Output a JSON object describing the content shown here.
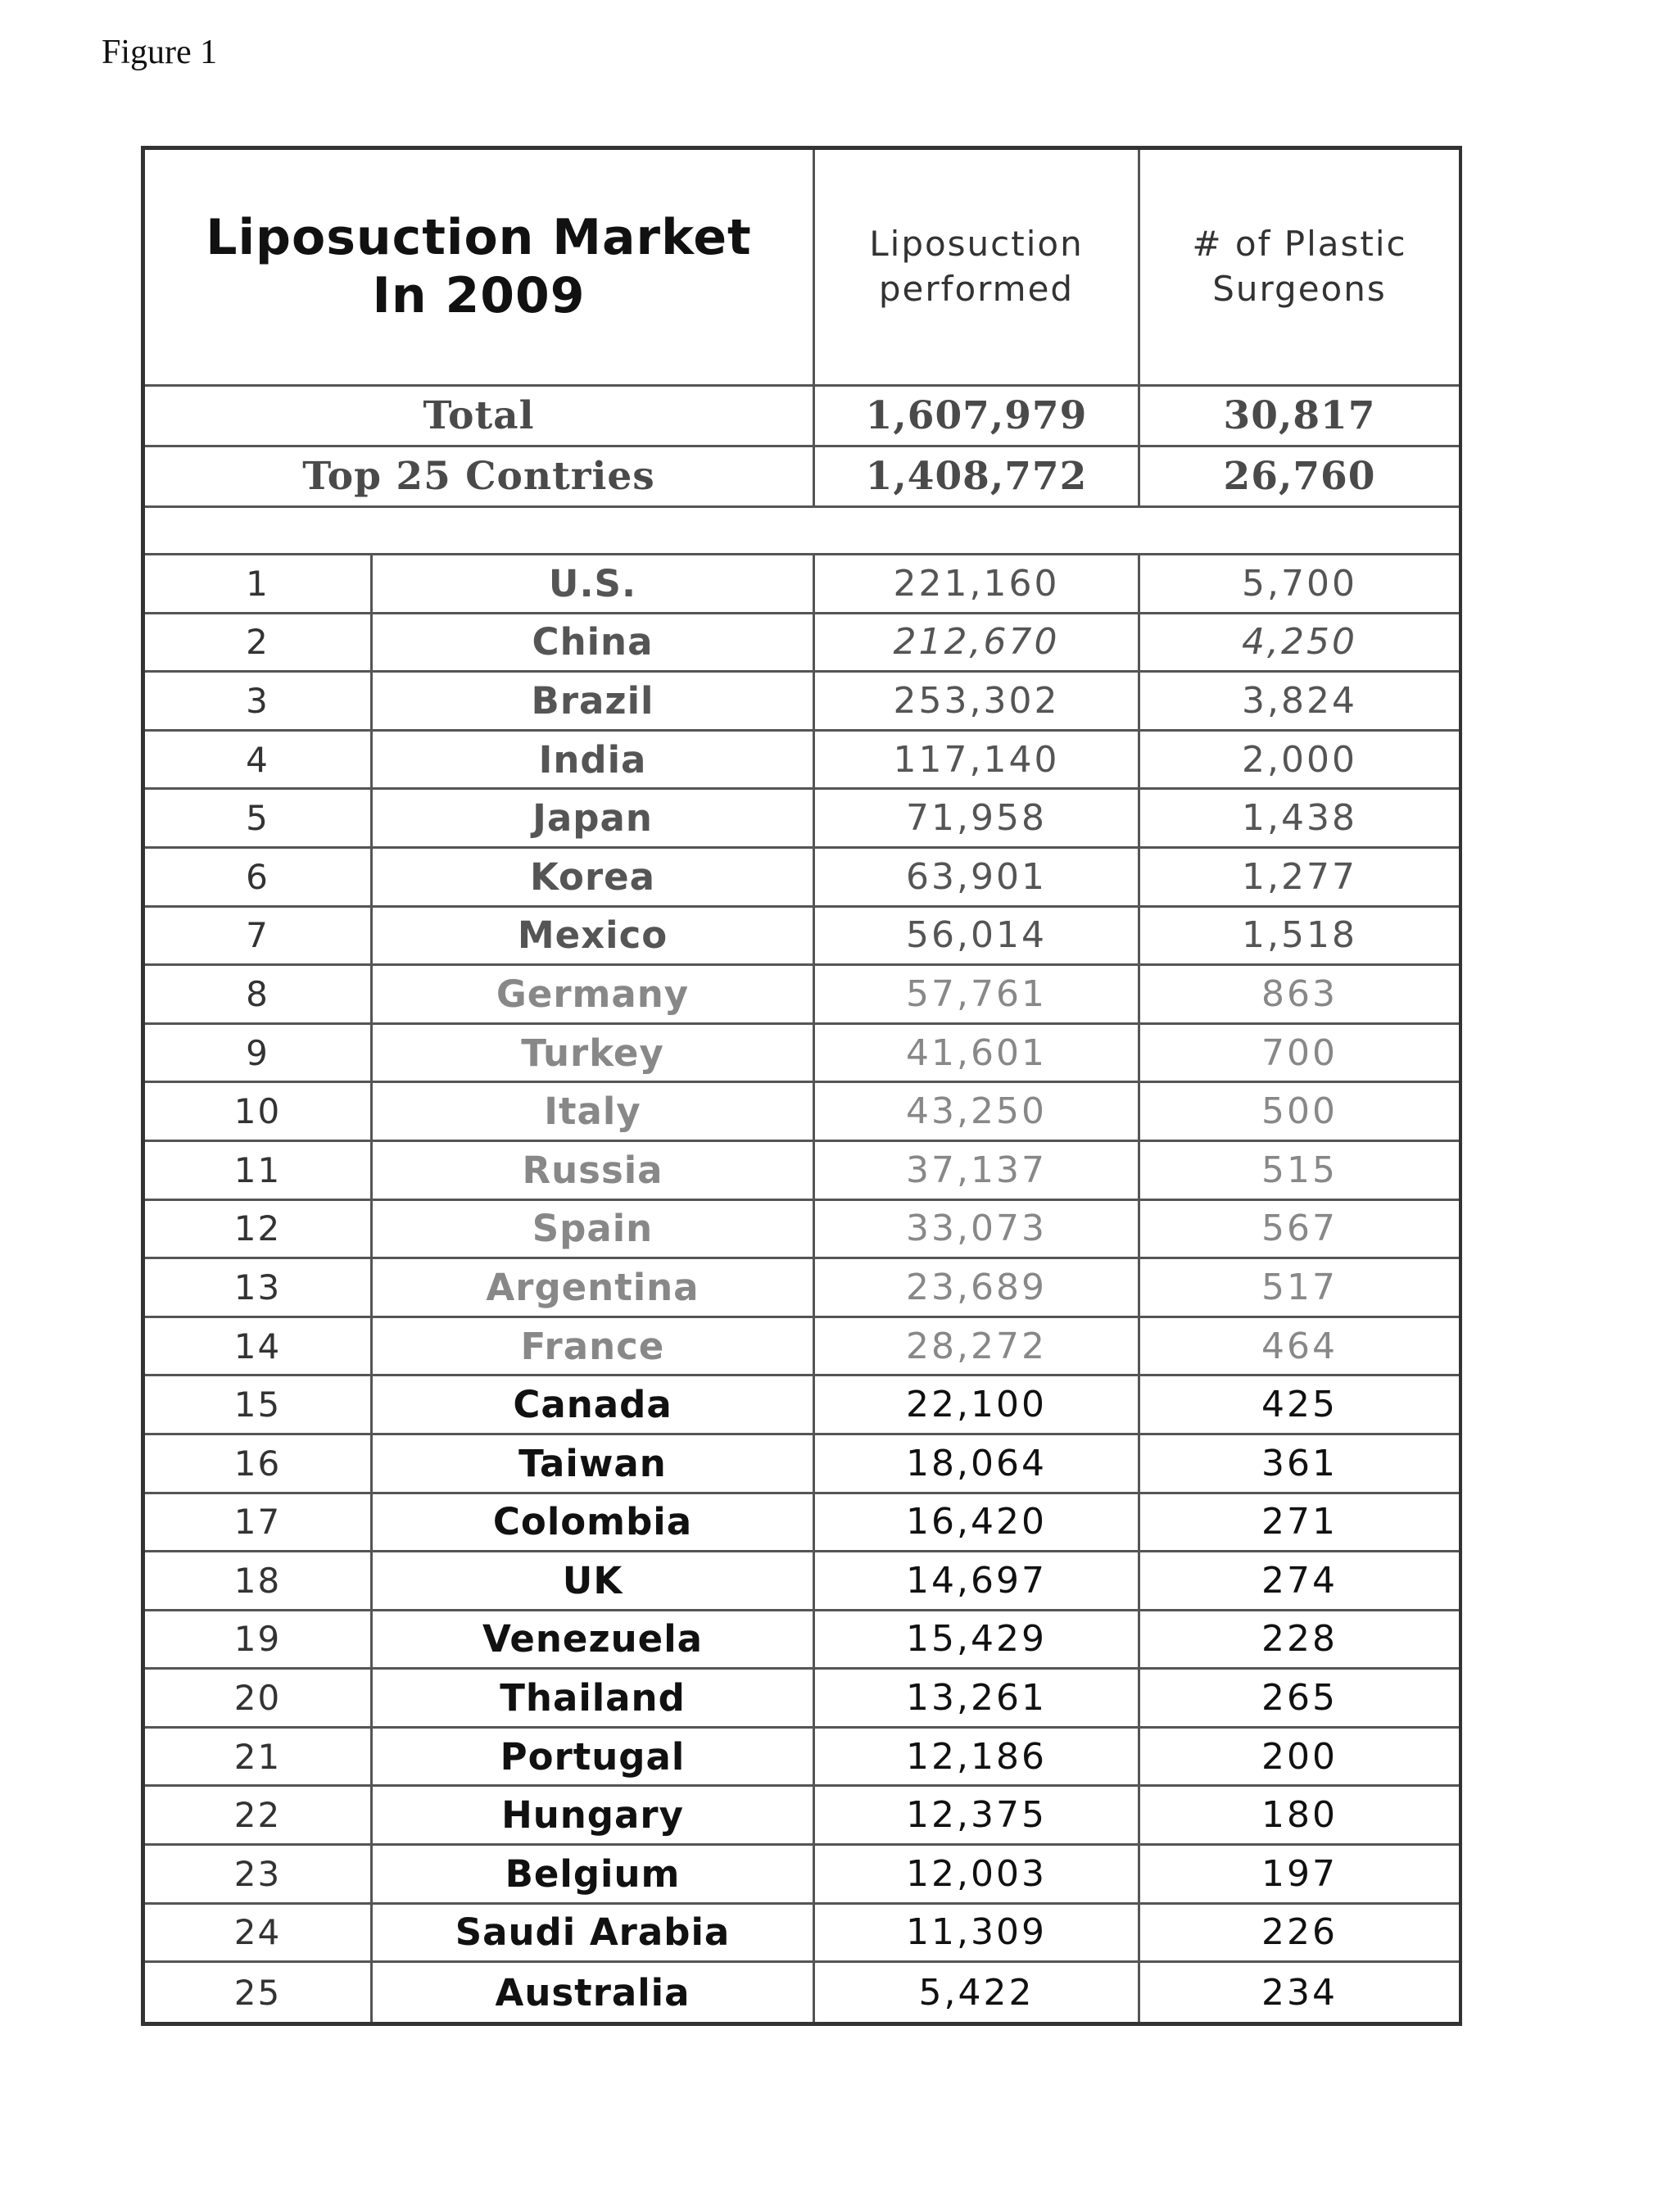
{
  "figure_label": "Figure 1",
  "table": {
    "title": "Liposuction Market In 2009",
    "title_line1": "Liposuction Market",
    "title_line2": "In 2009",
    "columns": {
      "liposuction_line1": "Liposuction",
      "liposuction_line2": "performed",
      "surgeons_line1": "# of Plastic",
      "surgeons_line2": "Surgeons"
    },
    "summary": [
      {
        "label": "Total",
        "liposuction": "1,607,979",
        "surgeons": "30,817"
      },
      {
        "label": "Top 25 Contries",
        "liposuction": "1,408,772",
        "surgeons": "26,760"
      }
    ],
    "rows": [
      {
        "rank": "1",
        "country": "U.S.",
        "liposuction": "221,160",
        "surgeons": "5,700",
        "tone": "mid"
      },
      {
        "rank": "2",
        "country": "China",
        "liposuction": "212,670",
        "surgeons": "4,250",
        "tone": "mid",
        "italic_values": true
      },
      {
        "rank": "3",
        "country": "Brazil",
        "liposuction": "253,302",
        "surgeons": "3,824",
        "tone": "mid"
      },
      {
        "rank": "4",
        "country": "India",
        "liposuction": "117,140",
        "surgeons": "2,000",
        "tone": "mid"
      },
      {
        "rank": "5",
        "country": "Japan",
        "liposuction": "71,958",
        "surgeons": "1,438",
        "tone": "mid"
      },
      {
        "rank": "6",
        "country": "Korea",
        "liposuction": "63,901",
        "surgeons": "1,277",
        "tone": "mid"
      },
      {
        "rank": "7",
        "country": "Mexico",
        "liposuction": "56,014",
        "surgeons": "1,518",
        "tone": "mid"
      },
      {
        "rank": "8",
        "country": "Germany",
        "liposuction": "57,761",
        "surgeons": "863",
        "tone": "light"
      },
      {
        "rank": "9",
        "country": "Turkey",
        "liposuction": "41,601",
        "surgeons": "700",
        "tone": "light"
      },
      {
        "rank": "10",
        "country": "Italy",
        "liposuction": "43,250",
        "surgeons": "500",
        "tone": "light"
      },
      {
        "rank": "11",
        "country": "Russia",
        "liposuction": "37,137",
        "surgeons": "515",
        "tone": "light"
      },
      {
        "rank": "12",
        "country": "Spain",
        "liposuction": "33,073",
        "surgeons": "567",
        "tone": "light"
      },
      {
        "rank": "13",
        "country": "Argentina",
        "liposuction": "23,689",
        "surgeons": "517",
        "tone": "light"
      },
      {
        "rank": "14",
        "country": "France",
        "liposuction": "28,272",
        "surgeons": "464",
        "tone": "light"
      },
      {
        "rank": "15",
        "country": "Canada",
        "liposuction": "22,100",
        "surgeons": "425",
        "tone": "dark"
      },
      {
        "rank": "16",
        "country": "Taiwan",
        "liposuction": "18,064",
        "surgeons": "361",
        "tone": "dark"
      },
      {
        "rank": "17",
        "country": "Colombia",
        "liposuction": "16,420",
        "surgeons": "271",
        "tone": "dark"
      },
      {
        "rank": "18",
        "country": "UK",
        "liposuction": "14,697",
        "surgeons": "274",
        "tone": "dark"
      },
      {
        "rank": "19",
        "country": "Venezuela",
        "liposuction": "15,429",
        "surgeons": "228",
        "tone": "dark"
      },
      {
        "rank": "20",
        "country": "Thailand",
        "liposuction": "13,261",
        "surgeons": "265",
        "tone": "dark"
      },
      {
        "rank": "21",
        "country": "Portugal",
        "liposuction": "12,186",
        "surgeons": "200",
        "tone": "dark"
      },
      {
        "rank": "22",
        "country": "Hungary",
        "liposuction": "12,375",
        "surgeons": "180",
        "tone": "dark"
      },
      {
        "rank": "23",
        "country": "Belgium",
        "liposuction": "12,003",
        "surgeons": "197",
        "tone": "dark"
      },
      {
        "rank": "24",
        "country": "Saudi Arabia",
        "liposuction": "11,309",
        "surgeons": "226",
        "tone": "dark"
      },
      {
        "rank": "25",
        "country": "Australia",
        "liposuction": "5,422",
        "surgeons": "234",
        "tone": "dark"
      }
    ]
  }
}
